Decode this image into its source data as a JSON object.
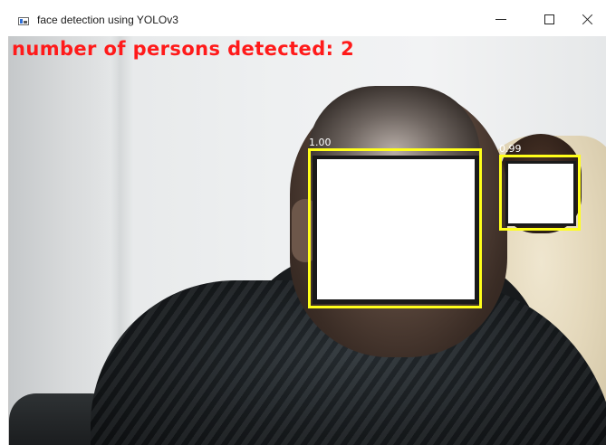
{
  "window": {
    "title": "face detection using YOLOv3",
    "controls": [
      "minimize",
      "maximize",
      "close"
    ],
    "icons": {
      "app": "app-window-icon",
      "minimize": "minimize-icon",
      "maximize": "maximize-icon",
      "close": "close-icon"
    }
  },
  "overlay": {
    "detected_text": "number of persons detected: 2",
    "text_color": "#ff1a1a",
    "box_color": "#ffff1a"
  },
  "detections": [
    {
      "label": "face",
      "confidence": "1.00"
    },
    {
      "label": "face",
      "confidence": "0.99"
    }
  ]
}
